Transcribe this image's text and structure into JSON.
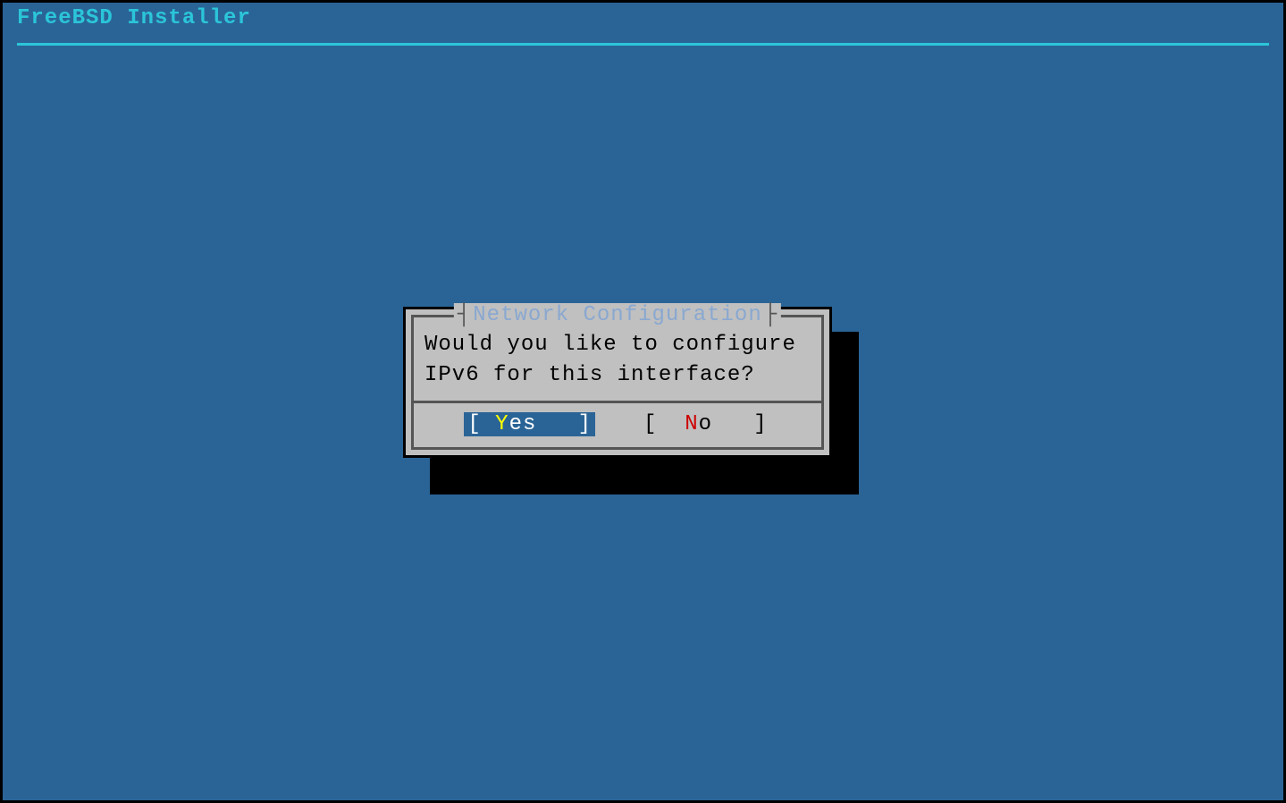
{
  "header": {
    "title": "FreeBSD Installer"
  },
  "dialog": {
    "title": "Network Configuration",
    "message_line1": "Would you like to configure",
    "message_line2": "IPv6 for this interface?",
    "yes": {
      "bracket_open": "[ ",
      "hotkey": "Y",
      "rest": "es  ",
      "bracket_close": " ]"
    },
    "no": {
      "bracket_open": "[  ",
      "hotkey": "N",
      "rest": "o  ",
      "bracket_close": " ]"
    }
  }
}
